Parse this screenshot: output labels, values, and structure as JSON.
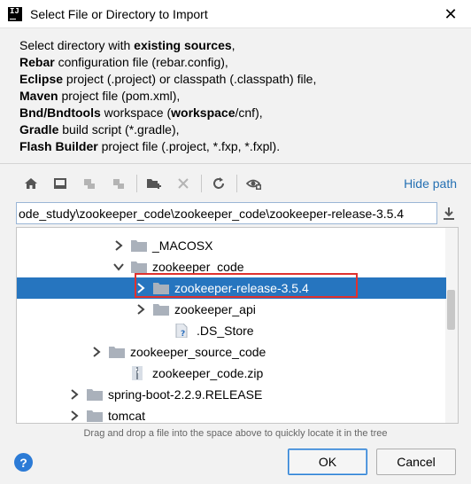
{
  "window": {
    "title": "Select File or Directory to Import",
    "close_glyph": "✕",
    "icon_label": "IJ"
  },
  "description": {
    "lines": [
      [
        {
          "t": "Select directory with ",
          "b": false
        },
        {
          "t": "existing sources",
          "b": true
        },
        {
          "t": ",",
          "b": false
        }
      ],
      [
        {
          "t": "Rebar",
          "b": true
        },
        {
          "t": " configuration file (rebar.config),",
          "b": false
        }
      ],
      [
        {
          "t": "Eclipse",
          "b": true
        },
        {
          "t": " project (.project) or classpath (.classpath) file,",
          "b": false
        }
      ],
      [
        {
          "t": "Maven",
          "b": true
        },
        {
          "t": " project file (pom.xml),",
          "b": false
        }
      ],
      [
        {
          "t": "Bnd/Bndtools",
          "b": true
        },
        {
          "t": " workspace (",
          "b": false
        },
        {
          "t": "workspace",
          "b": true
        },
        {
          "t": "/cnf),",
          "b": false
        }
      ],
      [
        {
          "t": "Gradle",
          "b": true
        },
        {
          "t": " build script (*.gradle),",
          "b": false
        }
      ],
      [
        {
          "t": "Flash Builder",
          "b": true
        },
        {
          "t": " project file (.project, *.fxp, *.fxpl).",
          "b": false
        }
      ]
    ]
  },
  "toolbar": {
    "hide_path_label": "Hide path",
    "buttons": [
      "home-icon",
      "desktop-icon",
      "project-icon",
      "module-icon",
      "new-folder-icon",
      "delete-icon",
      "refresh-icon",
      "show-hidden-icon"
    ]
  },
  "path": {
    "value": "ode_study\\zookeeper_code\\zookeeper_code\\zookeeper-release-3.5.4"
  },
  "tree": {
    "items": [
      {
        "label": "_MACOSX",
        "chevron": "right",
        "type": "folder",
        "selected": false
      },
      {
        "label": "zookeeper_code",
        "chevron": "down",
        "type": "folder",
        "selected": false
      },
      {
        "label": "zookeeper-release-3.5.4",
        "chevron": "right",
        "type": "folder",
        "selected": true
      },
      {
        "label": "zookeeper_api",
        "chevron": "right",
        "type": "folder",
        "selected": false
      },
      {
        "label": ".DS_Store",
        "chevron": "none",
        "type": "unknown-file",
        "selected": false
      },
      {
        "label": "zookeeper_source_code",
        "chevron": "right",
        "type": "folder",
        "selected": false
      },
      {
        "label": "zookeeper_code.zip",
        "chevron": "none",
        "type": "zip",
        "selected": false
      },
      {
        "label": "spring-boot-2.2.9.RELEASE",
        "chevron": "right",
        "type": "folder",
        "selected": false
      },
      {
        "label": "tomcat",
        "chevron": "right",
        "type": "folder",
        "selected": false
      }
    ]
  },
  "hint": "Drag and drop a file into the space above to quickly locate it in the tree",
  "buttons": {
    "help": "?",
    "ok": "OK",
    "cancel": "Cancel"
  },
  "colors": {
    "selection": "#2675bf",
    "link": "#2470b3",
    "highlight_box": "#e0312e"
  }
}
